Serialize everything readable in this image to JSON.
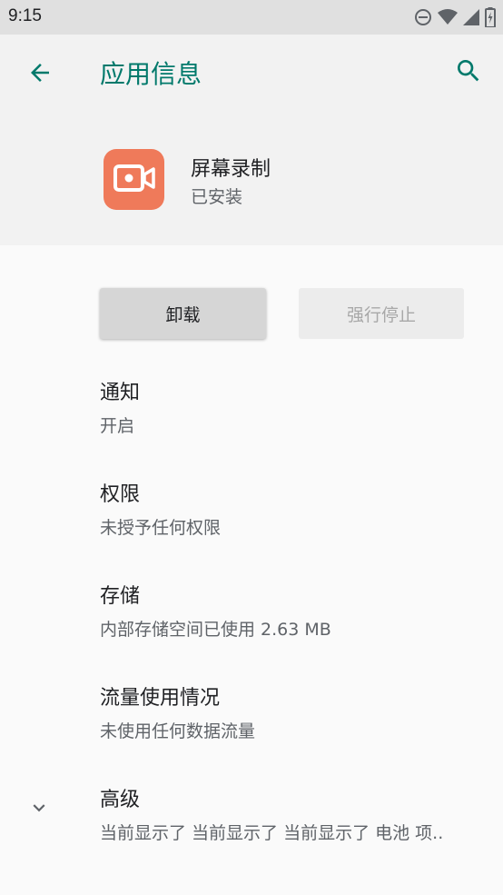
{
  "status_bar": {
    "time": "9:15",
    "icons": [
      "do-not-disturb-icon",
      "wifi-icon",
      "signal-icon",
      "battery-charging-icon"
    ]
  },
  "app_bar": {
    "title": "应用信息",
    "back_icon": "arrow-back-icon",
    "search_icon": "search-icon"
  },
  "app": {
    "name": "屏幕录制",
    "status": "已安装",
    "icon": "video-camera-icon",
    "icon_color": "#ef7a5a"
  },
  "buttons": {
    "uninstall": "卸载",
    "force_stop": "强行停止"
  },
  "items": [
    {
      "title": "通知",
      "subtitle": "开启"
    },
    {
      "title": "权限",
      "subtitle": "未授予任何权限"
    },
    {
      "title": "存储",
      "subtitle": "内部存储空间已使用 2.63 MB"
    },
    {
      "title": "流量使用情况",
      "subtitle": "未使用任何数据流量"
    },
    {
      "title": "高级",
      "subtitle": "当前显示了 当前显示了 当前显示了 电池 项.."
    }
  ],
  "colors": {
    "accent": "#00796b",
    "status_bar_bg": "#e0e0e0",
    "header_bg": "#f2f2f2",
    "page_bg": "#fafafa"
  }
}
